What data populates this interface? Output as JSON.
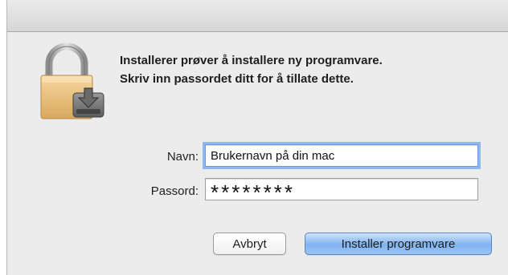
{
  "dialog": {
    "message_line1": "Installerer prøver å installere ny programvare.",
    "message_line2": "Skriv inn passordet ditt for å tillate dette."
  },
  "form": {
    "name_label": "Navn:",
    "name_value": "Brukernavn på din mac",
    "password_label": "Passord:",
    "password_value": "********"
  },
  "buttons": {
    "cancel_label": "Avbryt",
    "install_label": "Installer programvare"
  },
  "icons": {
    "lock": "padlock-installer-icon"
  },
  "colors": {
    "default_button": "#7fb3f0",
    "focus_ring": "#8fb8f2"
  }
}
